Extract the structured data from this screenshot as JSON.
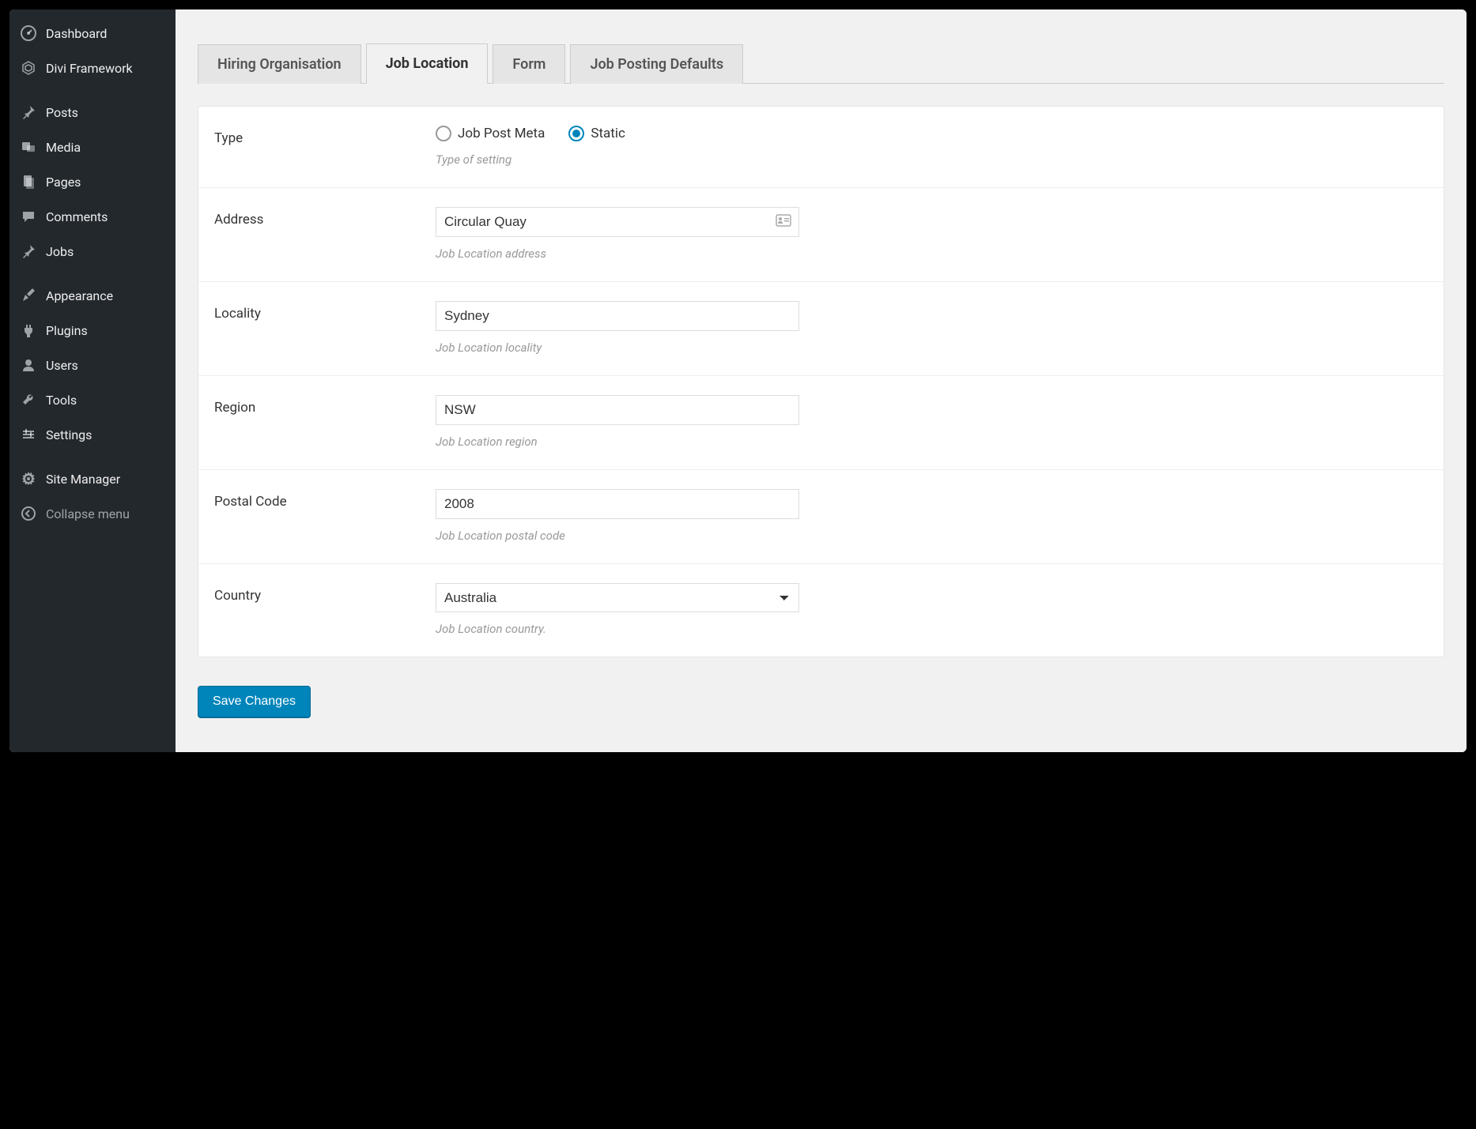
{
  "sidebar": {
    "items": [
      {
        "label": "Dashboard",
        "icon": "dashboard"
      },
      {
        "label": "Divi Framework",
        "icon": "divi"
      },
      {
        "label": "Posts",
        "icon": "pin"
      },
      {
        "label": "Media",
        "icon": "media"
      },
      {
        "label": "Pages",
        "icon": "pages"
      },
      {
        "label": "Comments",
        "icon": "comments"
      },
      {
        "label": "Jobs",
        "icon": "pin"
      },
      {
        "label": "Appearance",
        "icon": "appearance"
      },
      {
        "label": "Plugins",
        "icon": "plugins"
      },
      {
        "label": "Users",
        "icon": "users"
      },
      {
        "label": "Tools",
        "icon": "tools"
      },
      {
        "label": "Settings",
        "icon": "settings"
      },
      {
        "label": "Site Manager",
        "icon": "gear"
      }
    ],
    "collapse_label": "Collapse menu"
  },
  "tabs": [
    {
      "label": "Hiring Organisation",
      "active": false
    },
    {
      "label": "Job Location",
      "active": true
    },
    {
      "label": "Form",
      "active": false
    },
    {
      "label": "Job Posting Defaults",
      "active": false
    }
  ],
  "form": {
    "type": {
      "label": "Type",
      "options": [
        "Job Post Meta",
        "Static"
      ],
      "selected": "Static",
      "help": "Type of setting"
    },
    "address": {
      "label": "Address",
      "value": "Circular Quay",
      "help": "Job Location address"
    },
    "locality": {
      "label": "Locality",
      "value": "Sydney",
      "help": "Job Location locality"
    },
    "region": {
      "label": "Region",
      "value": "NSW",
      "help": "Job Location region"
    },
    "postal_code": {
      "label": "Postal Code",
      "value": "2008",
      "help": "Job Location postal code"
    },
    "country": {
      "label": "Country",
      "value": "Australia",
      "help": "Job Location country."
    }
  },
  "save_button": "Save Changes"
}
